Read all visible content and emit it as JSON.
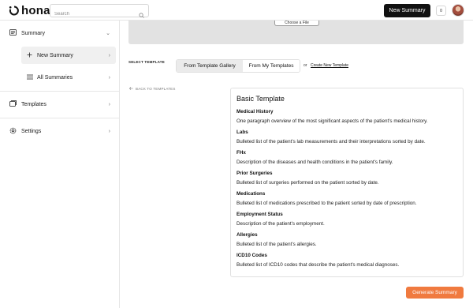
{
  "app": {
    "logo_text": "hona"
  },
  "search": {
    "placeholder": "Search"
  },
  "header": {
    "new_summary_label": "New Summary",
    "badge_count": "0"
  },
  "sidebar": {
    "items": [
      {
        "label": "Summary",
        "chevron": "⌄"
      },
      {
        "label": "New Summary",
        "chevron": "›"
      },
      {
        "label": "All Summaries",
        "chevron": "›"
      },
      {
        "label": "Templates",
        "chevron": "›"
      },
      {
        "label": "Settings",
        "chevron": "›"
      }
    ]
  },
  "preview": {
    "choose_label": "Choose a File"
  },
  "template_select": {
    "label": "SELECT TEMPLATE",
    "tabs": [
      "From Template Gallery",
      "From My Templates"
    ],
    "or": "or",
    "create_link": "Create New Template"
  },
  "back_link": "BACK TO TEMPLATES",
  "template": {
    "title": "Basic Template",
    "sections": [
      {
        "heading": "Medical History",
        "description": "One paragraph overview of the most significant aspects of the patient's medical history."
      },
      {
        "heading": "Labs",
        "description": "Bulleted list of the patient's lab measurements and their interpretations sorted by date."
      },
      {
        "heading": "FHx",
        "description": "Description of the diseases and health conditions in the patient's family."
      },
      {
        "heading": "Prior Surgeries",
        "description": "Bulleted list of surgeries performed on the patient sorted by date."
      },
      {
        "heading": "Medications",
        "description": "Bulleted list of medications prescribed to the patient sorted by date of prescription."
      },
      {
        "heading": "Employment Status",
        "description": "Description of the patient's employment."
      },
      {
        "heading": "Allergies",
        "description": "Bulleted list of the patient's allergies."
      },
      {
        "heading": "ICD10 Codes",
        "description": "Bulleted list of ICD10 codes that describe the patient's medical diagnoses."
      }
    ]
  },
  "actions": {
    "generate_label": "Generate Summary"
  },
  "colors": {
    "accent": "#f07a3f",
    "primary_button": "#111111",
    "active_bg": "#f0f0f0"
  }
}
